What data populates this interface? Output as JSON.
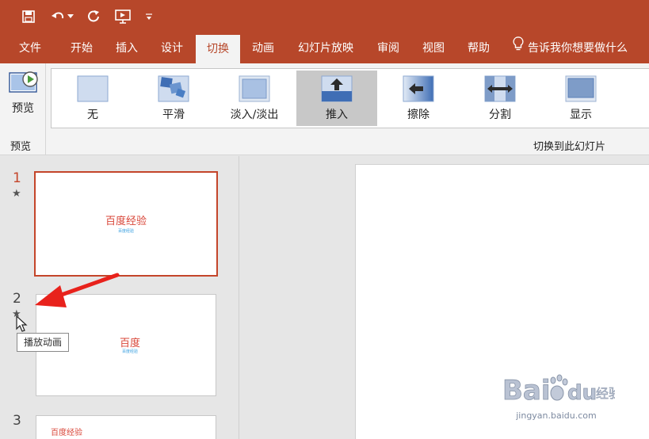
{
  "qat": {
    "icons": [
      "save-icon",
      "undo-icon",
      "redo-icon",
      "present-icon",
      "customize-icon"
    ]
  },
  "tabs": [
    {
      "label": "文件",
      "active": false
    },
    {
      "label": "开始",
      "active": false
    },
    {
      "label": "插入",
      "active": false
    },
    {
      "label": "设计",
      "active": false
    },
    {
      "label": "切换",
      "active": true
    },
    {
      "label": "动画",
      "active": false
    },
    {
      "label": "幻灯片放映",
      "active": false
    },
    {
      "label": "审阅",
      "active": false
    },
    {
      "label": "视图",
      "active": false
    },
    {
      "label": "帮助",
      "active": false
    }
  ],
  "tellme": "告诉我你想要做什么",
  "ribbon": {
    "preview_label": "预览",
    "preview_group_label": "预览",
    "transitions_group_label": "切换到此幻灯片",
    "effects": [
      {
        "label": "无",
        "selected": false
      },
      {
        "label": "平滑",
        "selected": false
      },
      {
        "label": "淡入/淡出",
        "selected": false
      },
      {
        "label": "推入",
        "selected": true
      },
      {
        "label": "擦除",
        "selected": false
      },
      {
        "label": "分割",
        "selected": false
      },
      {
        "label": "显示",
        "selected": false
      }
    ]
  },
  "slides": [
    {
      "number": "1",
      "title": "百度经验",
      "subtitle": "百度经验",
      "active": true
    },
    {
      "number": "2",
      "title": "百度",
      "subtitle": "百度经验",
      "active": false
    },
    {
      "number": "3",
      "title": "百度经验",
      "subtitle": "",
      "active": false
    }
  ],
  "star": "★",
  "tooltip": "播放动画",
  "watermark": {
    "brand": "Baidu经验",
    "url": "jingyan.baidu.com"
  },
  "colors": {
    "accent": "#b7472a",
    "slide_title": "#d9473a",
    "arrow": "#e8221c"
  }
}
